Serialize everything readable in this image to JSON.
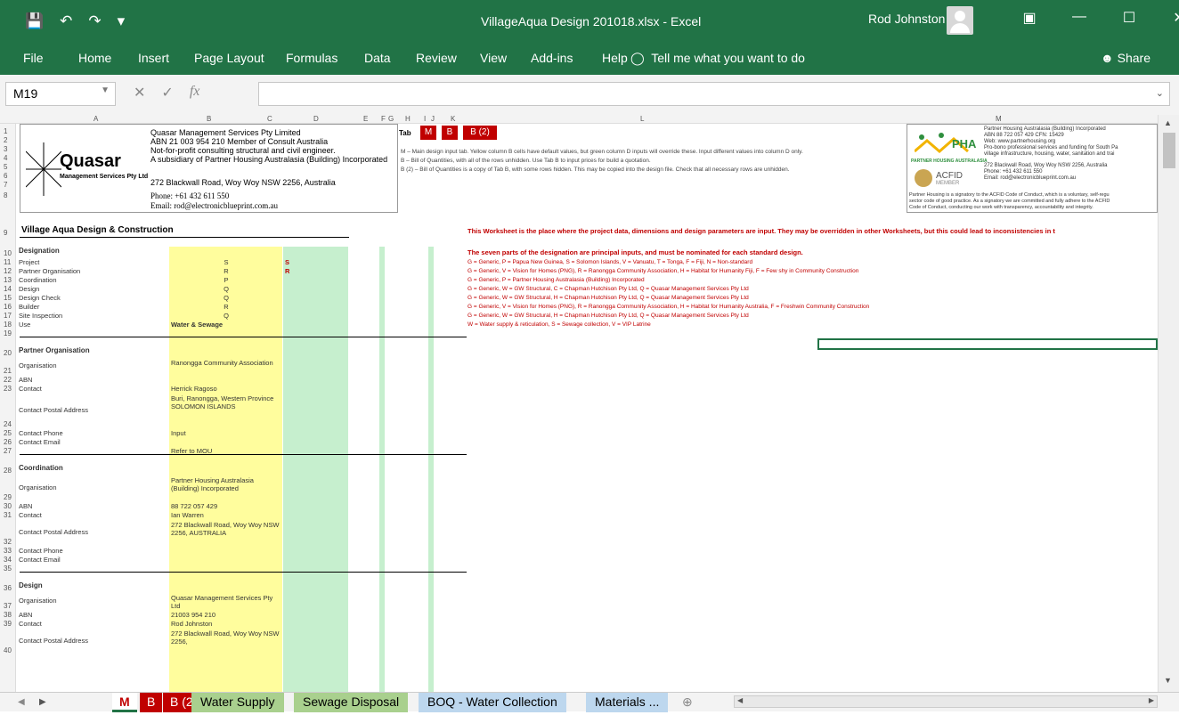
{
  "window": {
    "title": "VillageAqua Design 201018.xlsx  -  Excel",
    "user": "Rod Johnston"
  },
  "ribbon": {
    "tabs": [
      "File",
      "Home",
      "Insert",
      "Page Layout",
      "Formulas",
      "Data",
      "Review",
      "View",
      "Add-ins",
      "Help"
    ],
    "tell_me": "Tell me what you want to do",
    "share": "Share"
  },
  "formula_bar": {
    "name_box": "M19",
    "fx": "fx",
    "formula": ""
  },
  "columns": [
    "A",
    "B",
    "C",
    "D",
    "E",
    "F",
    "G",
    "H",
    "I",
    "J",
    "K",
    "L",
    "M"
  ],
  "company": {
    "name": "Quasar",
    "tagline": "Management Services Pty Ltd",
    "lines": [
      "Quasar Management Services Pty Limited",
      "ABN 21 003 954 210   Member of Consult Australia",
      "Not-for-profit consulting structural and civil engineer.",
      "A subsidiary of Partner Housing Australasia (Building) Incorporated"
    ],
    "address": "272 Blackwall Road, Woy Woy NSW 2256, Australia",
    "phone": "Phone: +61 432 611 550",
    "email": "Email: rod@electronicblueprint.com.au"
  },
  "tab_legend": {
    "label": "Tab",
    "tabs": [
      "M",
      "B",
      "B (2)"
    ],
    "notes": [
      "M – Main design input tab. Yellow column B cells have default values, but green column D inputs will override these. Input different values into column D only.",
      "B – Bill of Quantities, with all of the rows unhidden. Use Tab B to input prices for build a quotation.",
      "B (2) – Bill of Quantities is a copy of Tab B, with some rows hidden. This may be copied into the design file. Check that all necessary rows are unhidden."
    ]
  },
  "pha": {
    "logo": "PHA",
    "logo_sub": "PARTNER HOUSING AUSTRALASIA",
    "acfid": "ACFID",
    "acfid_sub": "MEMBER",
    "lines": [
      "Partner Housing Australasia (Building) Incorporated",
      "ABN 88 722 057 429 CFN: 15429",
      "Web: www.partnerhousing.org",
      "Pro-bono professional services and funding for South Pa",
      "village infrastructure, housing, water, sanitation and trai",
      "272 Blackwall Road, Woy Woy NSW 2256, Australia",
      "Phone: +61 432 611 550",
      "Email: rod@electronicblueprint.com.au"
    ],
    "footer": [
      "Partner Housing is a signatory to the ACFID Code of Conduct, which is a voluntary, self-regu",
      "sector code of good practice. As a signatory we are committed and fully adhere to the ACFID",
      "Code of Conduct, conducting our work with transparency, accountability and integrity."
    ]
  },
  "heading": "Village Aqua Design & Construction",
  "worksheet_note": "This Worksheet is the place where the project data, dimensions and design parameters are input. They may be overridden in other Worksheets, but this could lead to inconsistencies in t",
  "designation_note": "The seven parts of the designation are principal inputs, and must be nominated for each standard design.",
  "designation_codes": [
    "G = Generic, P = Papua New Guinea, S = Solomon Islands, V = Vanuatu, T = Tonga, F = Fiji, N = Non-standard",
    "G = Generic, V = Vision for Homes (PNG), R = Ranongga Community Association, H = Habitat for Humanity Fiji, F = Few shy in Community Construction",
    "G = Generic, P = Partner Housing Australasia (Building) Incorporated",
    "G = Generic, W = GW Structural, C = Chapman Hutchison Pty Ltd, Q = Quasar Management Services Pty Ltd",
    "G = Generic, W = GW Structural, H = Chapman Hutchison Pty Ltd, Q = Quasar Management Services Pty Ltd",
    "G = Generic, V = Vision for Homes (PNG), R = Ranongga Community Association, H = Habitat for Humanity Australia, F = Freshwin Community Construction",
    "G = Generic, W = GW Structural, H = Chapman Hutchison Pty Ltd, Q = Quasar Management Services Pty Ltd",
    "W = Water supply & reticulation, S = Sewage collection, V = VIP Latrine"
  ],
  "rows": [
    {
      "n": "10",
      "label": "Designation",
      "b": "",
      "d": "",
      "bold": true
    },
    {
      "n": "11",
      "label": "Project",
      "b": "S",
      "d": "S"
    },
    {
      "n": "12",
      "label": "Partner Organisation",
      "b": "R",
      "d": "R"
    },
    {
      "n": "13",
      "label": "Coordination",
      "b": "P",
      "d": ""
    },
    {
      "n": "14",
      "label": "Design",
      "b": "Q",
      "d": ""
    },
    {
      "n": "15",
      "label": "Design Check",
      "b": "Q",
      "d": ""
    },
    {
      "n": "16",
      "label": "Builder",
      "b": "R",
      "d": ""
    },
    {
      "n": "17",
      "label": "Site Inspection",
      "b": "Q",
      "d": ""
    },
    {
      "n": "18",
      "label": "Use",
      "b": "Water & Sewage",
      "d": "",
      "bb": true
    },
    {
      "n": "19",
      "label": "",
      "b": "",
      "d": ""
    },
    {
      "n": "20",
      "label": "Partner Organisation",
      "b": "",
      "d": "",
      "bold": true
    },
    {
      "n": "21",
      "label": "Organisation",
      "b": "Ranongga Community Association",
      "d": ""
    },
    {
      "n": "22",
      "label": "ABN",
      "b": "",
      "d": ""
    },
    {
      "n": "23",
      "label": "Contact",
      "b": "Herrick Ragoso",
      "d": ""
    },
    {
      "n": "24",
      "label": "Contact Postal Address",
      "b": "Buri, Ranongga, Western Province SOLOMON ISLANDS",
      "d": ""
    },
    {
      "n": "25",
      "label": "Contact Phone",
      "b": "Input",
      "d": ""
    },
    {
      "n": "26",
      "label": "Contact Email",
      "b": "",
      "d": ""
    },
    {
      "n": "27",
      "label": "",
      "b": "Refer to MOU",
      "d": ""
    },
    {
      "n": "28",
      "label": "Coordination",
      "b": "",
      "d": "",
      "bold": true
    },
    {
      "n": "29",
      "label": "Organisation",
      "b": "Partner Housing Australasia (Building) Incorporated",
      "d": ""
    },
    {
      "n": "30",
      "label": "ABN",
      "b": "88 722 057 429",
      "d": ""
    },
    {
      "n": "31",
      "label": "Contact",
      "b": "Ian Warren",
      "d": ""
    },
    {
      "n": "32",
      "label": "Contact Postal Address",
      "b": "272 Blackwall Road, Woy Woy NSW 2256, AUSTRALIA",
      "d": ""
    },
    {
      "n": "33",
      "label": "Contact Phone",
      "b": "",
      "d": ""
    },
    {
      "n": "34",
      "label": "Contact Email",
      "b": "",
      "d": ""
    },
    {
      "n": "35",
      "label": "",
      "b": "",
      "d": ""
    },
    {
      "n": "36",
      "label": "Design",
      "b": "",
      "d": "",
      "bold": true
    },
    {
      "n": "37",
      "label": "Organisation",
      "b": "Quasar Management Services Pty Ltd",
      "d": ""
    },
    {
      "n": "38",
      "label": "ABN",
      "b": "21003 954 210",
      "d": ""
    },
    {
      "n": "39",
      "label": "Contact",
      "b": "Rod Johnston",
      "d": ""
    },
    {
      "n": "40",
      "label": "Contact Postal Address",
      "b": "272 Blackwall Road, Woy Woy NSW 2256,",
      "d": ""
    }
  ],
  "sheet_tabs": [
    "M",
    "B",
    "B (2)",
    "Water Supply",
    "Sewage Disposal",
    "BOQ - Water Collection",
    "Materials ..."
  ]
}
